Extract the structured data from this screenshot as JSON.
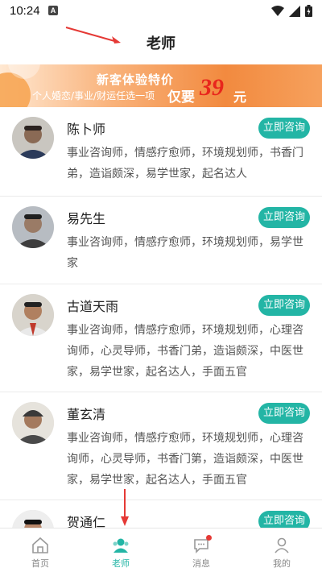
{
  "status_bar": {
    "time": "10:24",
    "notification_letter": "A"
  },
  "header": {
    "title": "老师"
  },
  "banner": {
    "title": "新客体验特价",
    "subtitle": "个人婚恋/事业/财运任选一项",
    "price_label": "仅要",
    "price": "39",
    "price_unit": "元"
  },
  "teachers": [
    {
      "name": "陈卜师",
      "consult_label": "立即咨询",
      "description": "事业咨询师，情感疗愈师，环境规划师，书香门弟，造诣颇深，易学世家，起名达人"
    },
    {
      "name": "易先生",
      "consult_label": "立即咨询",
      "description": "事业咨询师，情感疗愈师，环境规划师，易学世家"
    },
    {
      "name": "古道天雨",
      "consult_label": "立即咨询",
      "description": "事业咨询师，情感疗愈师，环境规划师，心理咨询师，心灵导师，书香门弟，造诣颇深，中医世家，易学世家，起名达人，手面五官"
    },
    {
      "name": "董玄清",
      "consult_label": "立即咨询",
      "description": "事业咨询师，情感疗愈师，环境规划师，心理咨询师，心灵导师，书香门第，造诣颇深，中医世家，易学世家，起名达人，手面五官"
    },
    {
      "name": "贺通仁",
      "consult_label": "立即咨询",
      "description": ""
    }
  ],
  "bottom_nav": [
    {
      "label": "首页",
      "icon": "home-icon",
      "active": false
    },
    {
      "label": "老师",
      "icon": "teacher-icon",
      "active": true
    },
    {
      "label": "消息",
      "icon": "message-icon",
      "active": false,
      "badge": true
    },
    {
      "label": "我的",
      "icon": "profile-icon",
      "active": false
    }
  ],
  "colors": {
    "accent": "#23b5a5",
    "banner_orange": "#f28a3f",
    "price_red": "#e8261c",
    "annotation_arrow": "#e53935"
  }
}
